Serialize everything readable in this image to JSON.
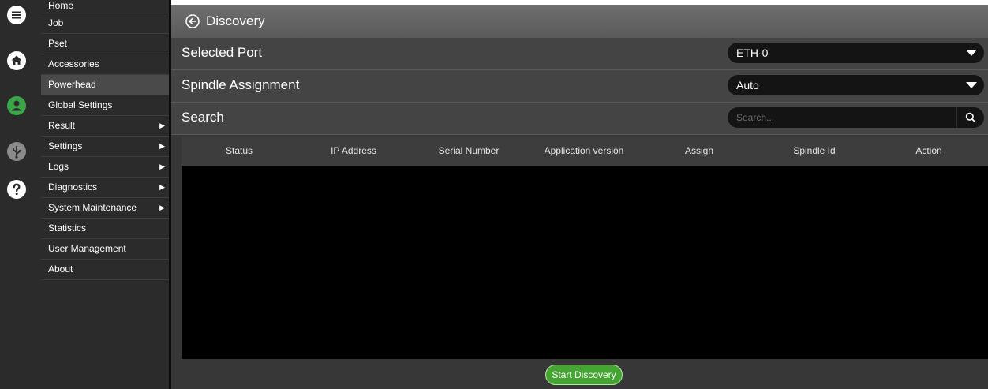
{
  "menu": {
    "items": [
      {
        "label": "Home",
        "submenu": false,
        "selected": false
      },
      {
        "label": "Job",
        "submenu": false,
        "selected": false
      },
      {
        "label": "Pset",
        "submenu": false,
        "selected": false
      },
      {
        "label": "Accessories",
        "submenu": false,
        "selected": false
      },
      {
        "label": "Powerhead",
        "submenu": false,
        "selected": true
      },
      {
        "label": "Global Settings",
        "submenu": false,
        "selected": false
      },
      {
        "label": "Result",
        "submenu": true,
        "selected": false
      },
      {
        "label": "Settings",
        "submenu": true,
        "selected": false
      },
      {
        "label": "Logs",
        "submenu": true,
        "selected": false
      },
      {
        "label": "Diagnostics",
        "submenu": true,
        "selected": false
      },
      {
        "label": "System Maintenance",
        "submenu": true,
        "selected": false
      },
      {
        "label": "Statistics",
        "submenu": false,
        "selected": false
      },
      {
        "label": "User Management",
        "submenu": false,
        "selected": false
      },
      {
        "label": "About",
        "submenu": false,
        "selected": false
      }
    ],
    "submenu_arrow": "▶"
  },
  "rail": {
    "icons": [
      "menu-icon",
      "home-icon",
      "user-icon",
      "usb-icon",
      "help-icon"
    ],
    "user_icon_color": "#3aa64a"
  },
  "page": {
    "title": "Discovery"
  },
  "selected_port": {
    "label": "Selected Port",
    "value": "ETH-0"
  },
  "spindle_assignment": {
    "label": "Spindle Assignment",
    "value": "Auto"
  },
  "search": {
    "label": "Search",
    "placeholder": "Search..."
  },
  "table": {
    "columns": [
      "Status",
      "IP Address",
      "Serial Number",
      "Application version",
      "Assign",
      "Spindle Id",
      "Action"
    ],
    "rows": []
  },
  "actions": {
    "start_discovery": "Start Discovery"
  },
  "colors": {
    "accent_green": "#45a532",
    "panel": "#373737",
    "sidebar": "#2b2b2b"
  }
}
